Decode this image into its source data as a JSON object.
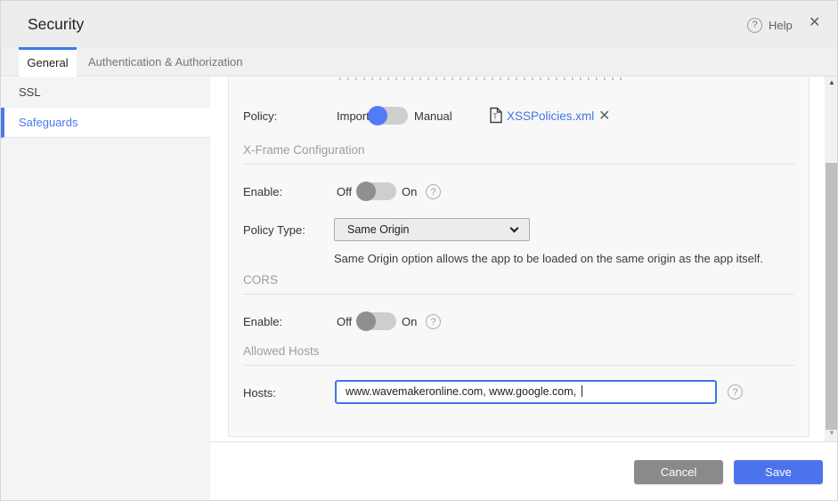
{
  "header": {
    "title": "Security",
    "help_label": "Help"
  },
  "tabs": {
    "general": "General",
    "auth": "Authentication & Authorization"
  },
  "sidebar": {
    "items": [
      {
        "label": "SSL"
      },
      {
        "label": "Safeguards"
      }
    ]
  },
  "policy_row": {
    "label": "Policy:",
    "toggle_left": "Import",
    "toggle_right": "Manual",
    "file_name": "XSSPolicies.xml"
  },
  "xframe": {
    "title": "X-Frame Configuration",
    "enable_label": "Enable:",
    "off": "Off",
    "on": "On",
    "policy_type_label": "Policy Type:",
    "policy_type_value": "Same Origin",
    "description": "Same Origin option allows the app to be loaded on the same origin as the app itself."
  },
  "cors": {
    "title": "CORS",
    "enable_label": "Enable:",
    "off": "Off",
    "on": "On"
  },
  "allowed_hosts": {
    "title": "Allowed Hosts",
    "hosts_label": "Hosts:",
    "hosts_value": "www.wavemakeronline.com, www.google.com, "
  },
  "footer": {
    "cancel": "Cancel",
    "save": "Save"
  },
  "icons": {
    "help_glyph": "?",
    "close_glyph": "✕",
    "file_remove_glyph": "✕",
    "scroll_up": "▲",
    "scroll_down": "▼",
    "file_letter": "T"
  },
  "colors": {
    "accent_blue": "#4b73ee",
    "toggle_blue": "#527cf5",
    "link_blue": "#4075e1",
    "tab_active_border": "#3b78e7",
    "sidebar_selected_blue": "#4b7bea",
    "cancel_gray": "#8a8a8a"
  }
}
